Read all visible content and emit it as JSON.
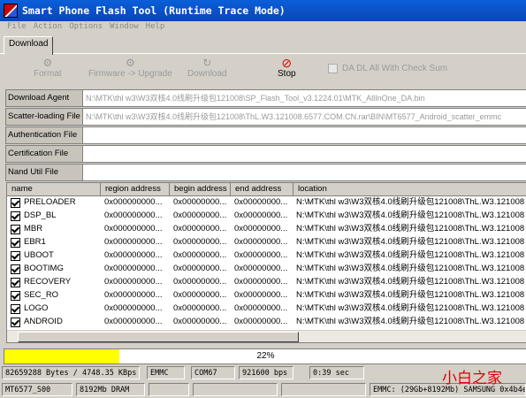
{
  "window": {
    "title": "Smart Phone Flash Tool (Runtime Trace Mode)"
  },
  "menu": [
    "File",
    "Action",
    "Options",
    "Window",
    "Help"
  ],
  "tabs": [
    {
      "label": "Download"
    }
  ],
  "toolbar": {
    "format": "Format",
    "firmware_upgrade": "Firmware -> Upgrade",
    "download": "Download",
    "stop": "Stop",
    "da_dl_all": "DA DL All With Check Sum"
  },
  "fields": [
    {
      "label": "Download Agent",
      "value": "N:\\MTK\\thl w3\\W3双核4.0线刷升级包121008\\SP_Flash_Tool_v3.1224.01\\MTK_AllInOne_DA.bin"
    },
    {
      "label": "Scatter-loading File",
      "value": "N:\\MTK\\thl w3\\W3双核4.0线刷升级包121008\\ThL.W3.121008.6577.COM.CN.rar\\BIN\\MT6577_Android_scatter_emmc"
    },
    {
      "label": "Authentication File",
      "value": ""
    },
    {
      "label": "Certification File",
      "value": ""
    },
    {
      "label": "Nand Util File",
      "value": ""
    }
  ],
  "table": {
    "columns": [
      "name",
      "region address",
      "begin address",
      "end address",
      "location"
    ],
    "rows": [
      {
        "name": "PRELOADER",
        "region": "0x000000000...",
        "begin": "0x00000000...",
        "end": "0x00000000...",
        "location": "N:\\MTK\\thl w3\\W3双核4.0线刷升级包121008\\ThL.W3.121008"
      },
      {
        "name": "DSP_BL",
        "region": "0x000000000...",
        "begin": "0x00000000...",
        "end": "0x00000000...",
        "location": "N:\\MTK\\thl w3\\W3双核4.0线刷升级包121008\\ThL.W3.121008"
      },
      {
        "name": "MBR",
        "region": "0x000000000...",
        "begin": "0x00000000...",
        "end": "0x00000000...",
        "location": "N:\\MTK\\thl w3\\W3双核4.0线刷升级包121008\\ThL.W3.121008"
      },
      {
        "name": "EBR1",
        "region": "0x000000000...",
        "begin": "0x00000000...",
        "end": "0x00000000...",
        "location": "N:\\MTK\\thl w3\\W3双核4.0线刷升级包121008\\ThL.W3.121008"
      },
      {
        "name": "UBOOT",
        "region": "0x000000000...",
        "begin": "0x00000000...",
        "end": "0x00000000...",
        "location": "N:\\MTK\\thl w3\\W3双核4.0线刷升级包121008\\ThL.W3.121008"
      },
      {
        "name": "BOOTIMG",
        "region": "0x000000000...",
        "begin": "0x00000000...",
        "end": "0x00000000...",
        "location": "N:\\MTK\\thl w3\\W3双核4.0线刷升级包121008\\ThL.W3.121008"
      },
      {
        "name": "RECOVERY",
        "region": "0x000000000...",
        "begin": "0x00000000...",
        "end": "0x00000000...",
        "location": "N:\\MTK\\thl w3\\W3双核4.0线刷升级包121008\\ThL.W3.121008"
      },
      {
        "name": "SEC_RO",
        "region": "0x000000000...",
        "begin": "0x00000000...",
        "end": "0x00000000...",
        "location": "N:\\MTK\\thl w3\\W3双核4.0线刷升级包121008\\ThL.W3.121008"
      },
      {
        "name": "LOGO",
        "region": "0x000000000...",
        "begin": "0x00000000...",
        "end": "0x00000000...",
        "location": "N:\\MTK\\thl w3\\W3双核4.0线刷升级包121008\\ThL.W3.121008"
      },
      {
        "name": "ANDROID",
        "region": "0x000000000...",
        "begin": "0x00000000...",
        "end": "0x00000000...",
        "location": "N:\\MTK\\thl w3\\W3双核4.0线刷升级包121008\\ThL.W3.121008"
      }
    ]
  },
  "progress": {
    "text": "22%",
    "fraction": 0.22,
    "color": "#ffff00"
  },
  "status_row1": [
    "82659288 Bytes / 4748.35 KBps",
    "EMMC",
    "COM67",
    "921600 bps",
    "0:39 sec"
  ],
  "status_row2": [
    "MT6577_S00",
    "8192Mb DRAM",
    "",
    "",
    "",
    "EMMC: (29Gb+8192Mb) SAMSUNG 0x4b4e"
  ],
  "watermark": "小白之家",
  "colors": {
    "titlebar": "#0a5fd8",
    "stop_icon": "#dd0000",
    "watermark": "#e00000"
  }
}
